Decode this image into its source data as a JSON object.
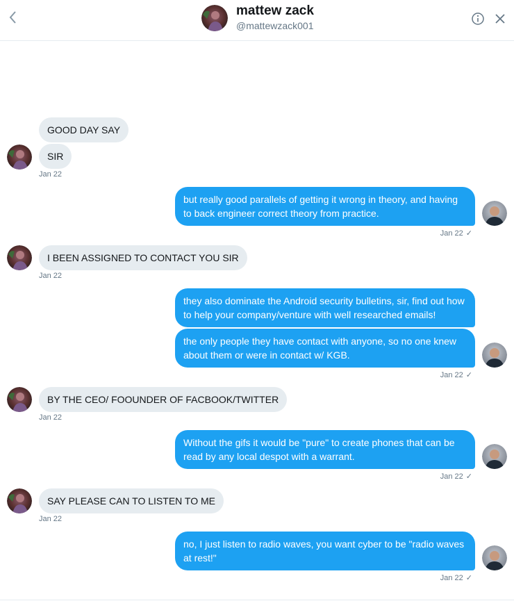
{
  "header": {
    "name": "mattew zack",
    "handle": "@mattewzack001"
  },
  "messages": {
    "m1": "GOOD DAY SAY",
    "m2": "SIR",
    "m2_time": "Jan 22",
    "m3": "but really good parallels of getting it wrong in theory, and having to back engineer correct theory from practice.",
    "m3_time": "Jan 22",
    "m4": "I BEEN ASSIGNED TO CONTACT YOU SIR",
    "m4_time": "Jan 22",
    "m5": "they also dominate the Android security bulletins, sir, find out how to help your company/venture with well researched emails!",
    "m6": "the only people they have contact with anyone, so no one knew about them or were in contact w/ KGB.",
    "m6_time": "Jan 22",
    "m7": "BY THE CEO/ FOOUNDER OF FACBOOK/TWITTER",
    "m7_time": "Jan 22",
    "m8": "Without the gifs it would be \"pure\" to create phones that can be read by any local despot with a warrant.",
    "m8_time": "Jan 22",
    "m9": "SAY PLEASE CAN TO LISTEN TO ME",
    "m9_time": "Jan 22",
    "m10": "no, I just listen to radio waves, you want cyber to be \"radio waves at rest!\"",
    "m10_time": "Jan 22"
  },
  "icons": {
    "back": "chevron-left-icon",
    "info": "info-icon",
    "close": "close-icon",
    "read_receipt": "check-icon"
  },
  "colors": {
    "outgoing_bubble": "#1da1f2",
    "incoming_bubble": "#e6ecf0",
    "secondary_text": "#657786"
  }
}
